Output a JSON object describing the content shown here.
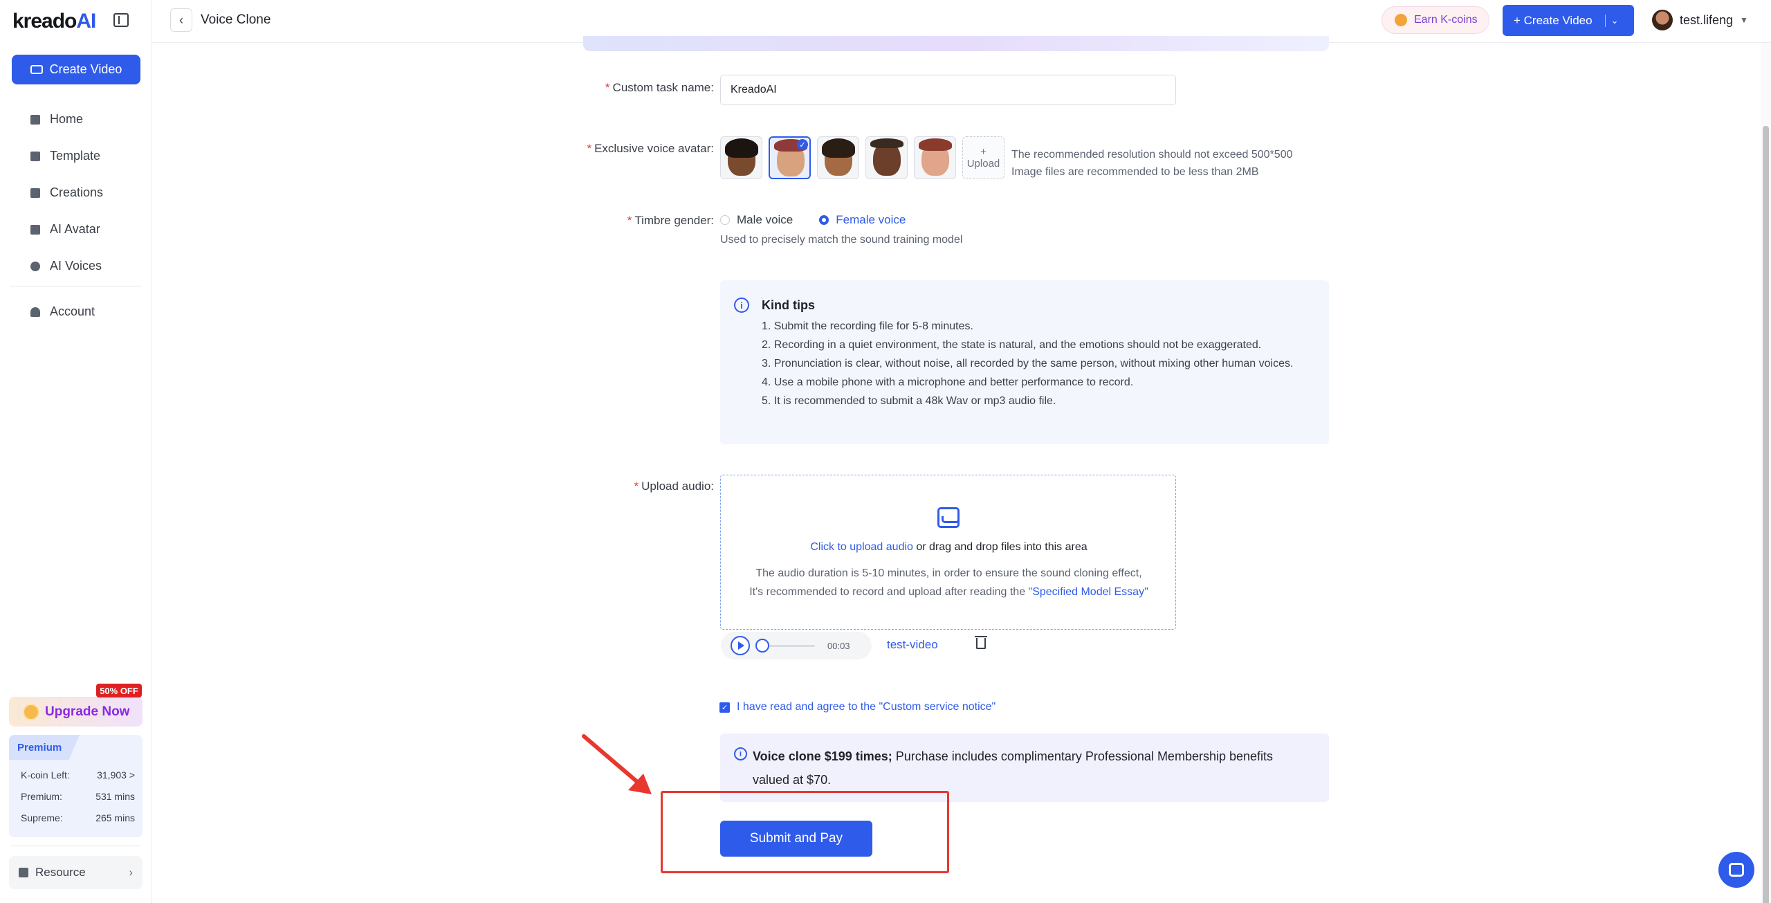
{
  "sidebar": {
    "logo_text": "kreado",
    "logo_accent": "AI",
    "create_label": "Create Video",
    "items": [
      {
        "label": "Home",
        "icon": "home-icon"
      },
      {
        "label": "Template",
        "icon": "template-icon"
      },
      {
        "label": "Creations",
        "icon": "folder-icon"
      },
      {
        "label": "AI Avatar",
        "icon": "avatar-icon"
      },
      {
        "label": "AI Voices",
        "icon": "voice-icon"
      }
    ],
    "account_label": "Account",
    "upgrade_badge": "50% OFF",
    "upgrade_label": "Upgrade Now",
    "premium": {
      "tag": "Premium",
      "rows": [
        {
          "label": "K-coin Left:",
          "value": "31,903 >"
        },
        {
          "label": "Premium:",
          "value": "531 mins"
        },
        {
          "label": "Supreme:",
          "value": "265 mins"
        }
      ]
    },
    "resource_label": "Resource"
  },
  "header": {
    "title": "Voice Clone",
    "earn_label": "Earn K-coins",
    "create_label": "+ Create Video",
    "username": "test.lifeng"
  },
  "form": {
    "task_name_label": "Custom task name:",
    "task_name_value": "KreadoAI",
    "avatar_label": "Exclusive voice avatar:",
    "upload_plus": "+",
    "upload_label": "Upload",
    "avatar_hint_1": "The recommended resolution should not exceed 500*500",
    "avatar_hint_2": "Image files are recommended to be less than 2MB",
    "gender_label": "Timbre gender:",
    "male_label": "Male voice",
    "female_label": "Female voice",
    "gender_sub": "Used to precisely match the sound training model",
    "tips": {
      "title": "Kind tips",
      "items": [
        "1. Submit the recording file for 5-8 minutes.",
        "2. Recording in a quiet environment, the state is natural, and the emotions should not be exaggerated.",
        "3. Pronunciation is clear, without noise, all recorded by the same person, without mixing other human voices.",
        "4. Use a mobile phone with a microphone and better performance to record.",
        "5. It is recommended to submit a 48k Wav or mp3 audio file."
      ]
    },
    "upload_audio_label": "Upload audio:",
    "dz_link": "Click to upload audio",
    "dz_rest": " or drag and drop files into this area",
    "dz_sub_1": "The audio duration is 5-10 minutes, in order to ensure the sound cloning effect,",
    "dz_sub_2": "It's recommended to record and upload after reading the ",
    "dz_sub_link": "\"Specified Model Essay\"",
    "player_time": "00:03",
    "file_name": "test-video",
    "agree_text": "I have read and agree to the \"Custom service notice\"",
    "notice_bold": "Voice clone $199 times;",
    "notice_rest": " Purchase includes complimentary Professional Membership benefits valued at $70.",
    "submit_label": "Submit and Pay"
  },
  "colors": {
    "accent": "#2f5bea",
    "danger": "#e8372f"
  }
}
